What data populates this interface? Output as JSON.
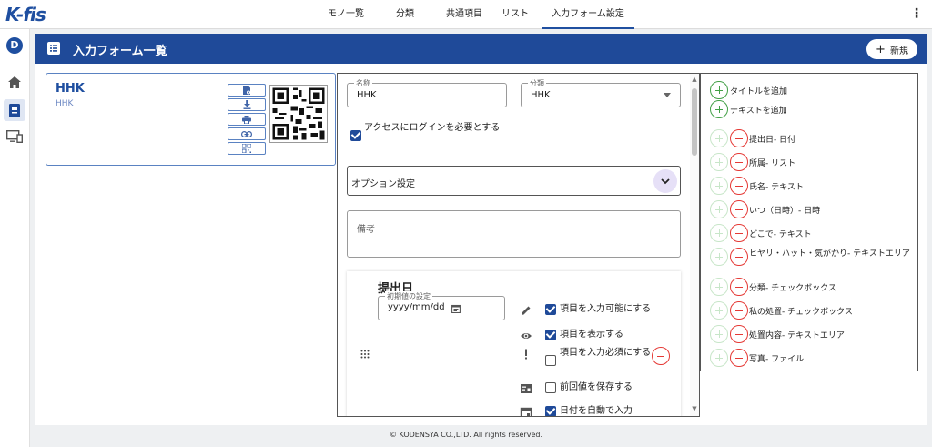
{
  "app": {
    "logo": "K-fis"
  },
  "topnav": {
    "tabs": [
      {
        "label": "モノ一覧",
        "active": false
      },
      {
        "label": "分類",
        "active": false
      },
      {
        "label": "共通項目",
        "active": false
      },
      {
        "label": "リスト",
        "active": false
      },
      {
        "label": "入力フォーム設定",
        "active": true
      }
    ]
  },
  "rail": {
    "badge": "D"
  },
  "panel": {
    "title": "入力フォーム一覧",
    "new_label": "新規"
  },
  "card": {
    "title": "HHK",
    "subtitle": "HHK"
  },
  "editor": {
    "name_label": "名称",
    "name_value": "HHK",
    "category_label": "分類",
    "category_value": "HHK",
    "login_required_label": "アクセスにログインを必要とする",
    "login_required_checked": true,
    "options_label": "オプション設定",
    "remarks_placeholder": "備考",
    "item": {
      "title": "提出日",
      "initial_label": "初期値の設定",
      "initial_placeholder": "yyyy/mm/dd",
      "options": [
        {
          "label": "項目を入力可能にする",
          "checked": true,
          "icon": "pencil-icon"
        },
        {
          "label": "項目を表示する",
          "checked": true,
          "icon": "eye-icon"
        },
        {
          "label": "項目を入力必須にする",
          "checked": false,
          "icon": "exclamation-icon"
        },
        {
          "label": "前回値を保存する",
          "checked": false,
          "icon": "save-form-icon"
        },
        {
          "label": "日付を自動で入力",
          "checked": true,
          "icon": "calendar-icon"
        }
      ]
    }
  },
  "palette": {
    "add_items": [
      "タイトルを追加",
      "テキストを追加"
    ],
    "fields": [
      "提出日- 日付",
      "所属- リスト",
      "氏名- テキスト",
      "いつ（日時）- 日時",
      "どこで- テキスト",
      "ヒヤリ・ハット・気がかり- テキストエリア",
      "分類- チェックボックス",
      "私の処置- チェックボックス",
      "処置内容- テキストエリア",
      "写真- ファイル"
    ]
  },
  "footer": {
    "copyright": "© KODENSYA CO.,LTD. All rights reserved."
  },
  "colors": {
    "primary": "#1f4a99",
    "add": "#43a047",
    "remove": "#e53935"
  }
}
